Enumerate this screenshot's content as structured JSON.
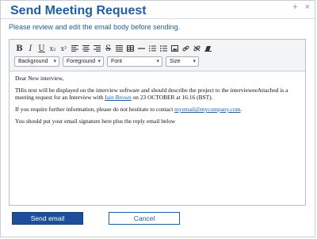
{
  "dialog": {
    "title": "Send Meeting Request",
    "controls": {
      "pin": "+",
      "close": "×"
    },
    "subtitle": "Please review and edit the email body before sending."
  },
  "toolbar": {
    "bold": "B",
    "italic": "I",
    "underline": "U",
    "subscript": "x₂",
    "superscript": "x²",
    "strikethrough": "S",
    "background_select": "Background",
    "foreground_select": "Foreground",
    "font_select": "Font",
    "size_select": "Size"
  },
  "email": {
    "greeting": "Dear New interview,",
    "para1_before": "THis text will be displayed on the interview software and should describe the project to the intervieweeAttached is a meeting request for an Interview with ",
    "para1_link": "Iain Brown",
    "para1_after": " on 23 OCTOBER at 16:16 (BST).",
    "para2_before": "If you require further information, please do not hestitate to contact ",
    "para2_link": "myemail@mycompany.com",
    "para2_after": ".",
    "para3": "You should put your email signature here plus the reply email below"
  },
  "buttons": {
    "send": "Send email",
    "cancel": "Cancel"
  },
  "colors": {
    "accent": "#1f5fa8",
    "primary_button": "#1b4e9b"
  }
}
